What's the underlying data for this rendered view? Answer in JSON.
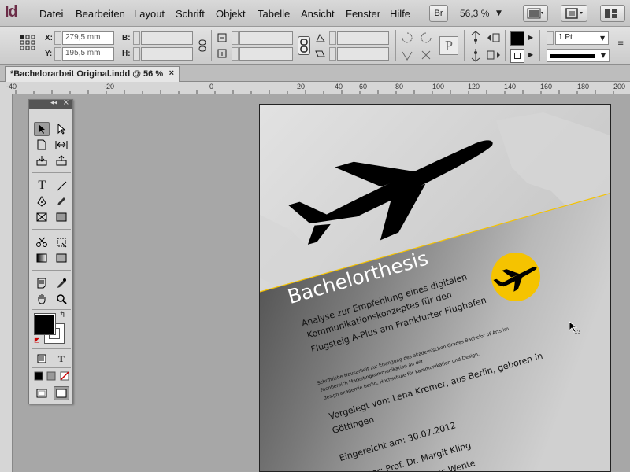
{
  "app": {
    "logo": "Id"
  },
  "menu": [
    "Datei",
    "Bearbeiten",
    "Layout",
    "Schrift",
    "Objekt",
    "Tabelle",
    "Ansicht",
    "Fenster",
    "Hilfe"
  ],
  "menubar": {
    "bridge_label": "Br",
    "zoom": "56,3 %"
  },
  "control": {
    "x_label": "X:",
    "x_value": "279,5 mm",
    "y_label": "Y:",
    "y_value": "195,5 mm",
    "w_label": "B:",
    "h_label": "H:",
    "stroke_weight": "1 Pt",
    "p_label": "P"
  },
  "tab": {
    "title": "*Bachelorarbeit Original.indd @ 56 %",
    "close": "×"
  },
  "ruler": [
    "-40",
    "-20",
    "0",
    "20",
    "40",
    "60",
    "80",
    "100",
    "120",
    "140",
    "160",
    "180",
    "200"
  ],
  "tools": {
    "type_glyph": "T",
    "formatting_text": "T"
  },
  "document": {
    "title": "Bachelorthesis",
    "subtitle_1": "Analyse zur Empfehlung eines digitalen",
    "subtitle_2": "Kommunikationskonzeptes für den",
    "subtitle_3": "Flugsteig A-Plus am Frankfurter Flughafen",
    "small_1": "Schriftliche Hausarbeit zur Erlangung des akademischen Grades Bachelor of Arts im",
    "small_2": "Fachbereich Marketingkommunikation an der",
    "small_3": "design akademie berlin, Hochschule für Kommunikation und Design.",
    "presented_1": "Vorgelegt von: Lena Kremer, aus Berlin, geboren in",
    "presented_2": "Göttingen",
    "submitted": "Eingereicht am: 30.07.2012",
    "advisor_1": "tor: Prof. Dr. Margit Kling",
    "advisor_2": "Markus Wente"
  },
  "colors": {
    "accent_yellow": "#f5c300",
    "indesign_logo": "#6b2c47"
  }
}
